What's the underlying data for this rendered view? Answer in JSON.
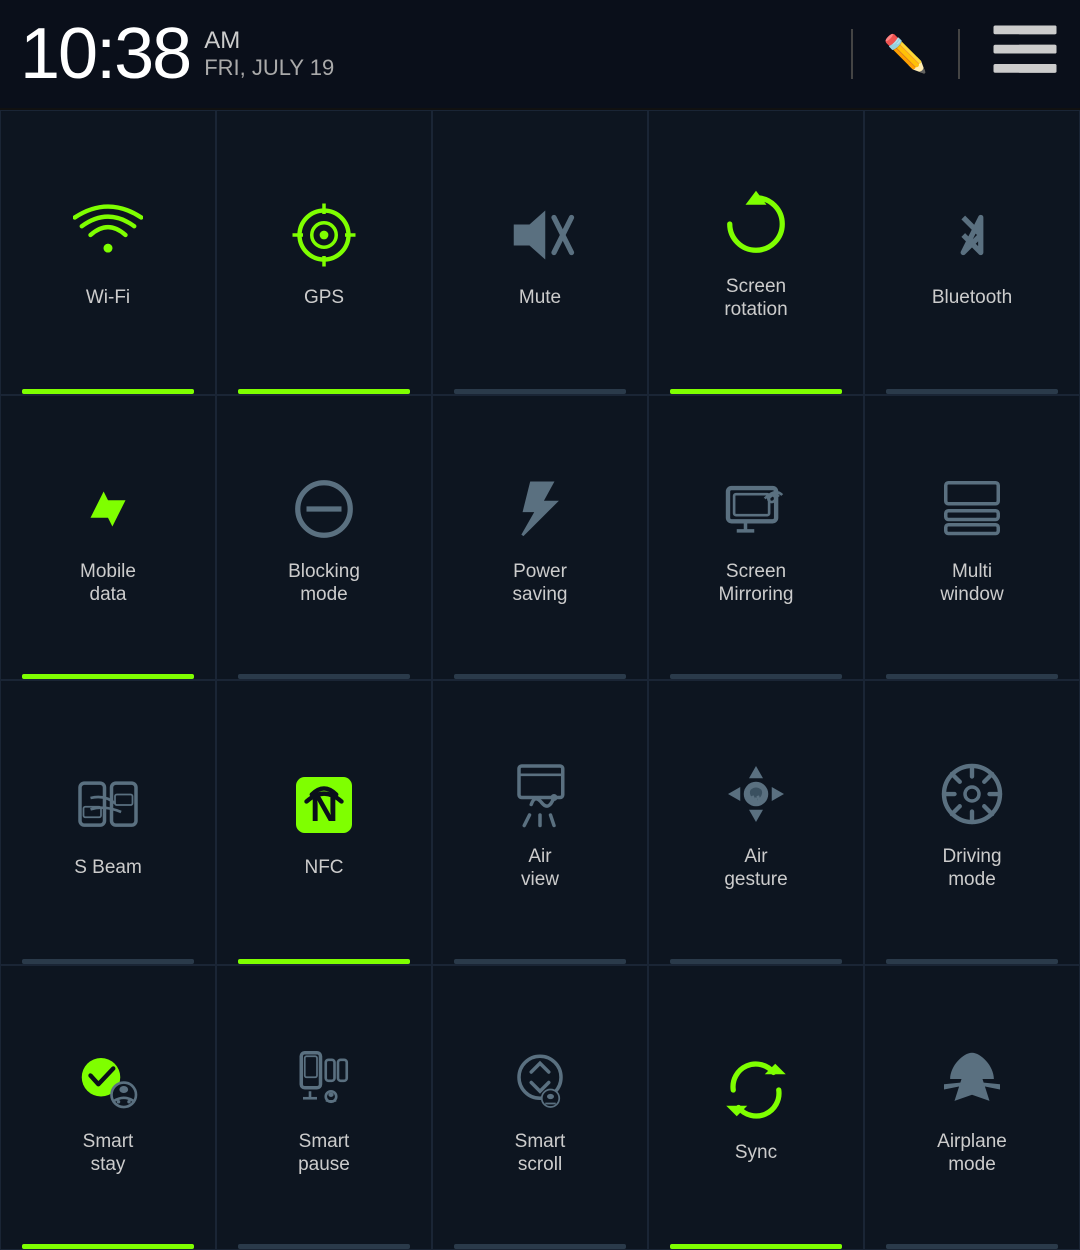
{
  "statusBar": {
    "time": "10:38",
    "ampm": "AM",
    "date": "FRI, JULY 19",
    "editIcon": "✏",
    "menuIcon": "≡"
  },
  "tiles": [
    {
      "id": "wifi",
      "label": "Wi-Fi",
      "active": true,
      "icon": "wifi"
    },
    {
      "id": "gps",
      "label": "GPS",
      "active": true,
      "icon": "gps"
    },
    {
      "id": "mute",
      "label": "Mute",
      "active": false,
      "icon": "mute"
    },
    {
      "id": "screen-rotation",
      "label": "Screen\nrotation",
      "active": true,
      "icon": "rotation"
    },
    {
      "id": "bluetooth",
      "label": "Bluetooth",
      "active": false,
      "icon": "bluetooth"
    },
    {
      "id": "mobile-data",
      "label": "Mobile\ndata",
      "active": true,
      "icon": "mobile-data"
    },
    {
      "id": "blocking-mode",
      "label": "Blocking\nmode",
      "active": false,
      "icon": "blocking"
    },
    {
      "id": "power-saving",
      "label": "Power\nsaving",
      "active": false,
      "icon": "power-saving"
    },
    {
      "id": "screen-mirroring",
      "label": "Screen\nMirroring",
      "active": false,
      "icon": "screen-mirroring"
    },
    {
      "id": "multi-window",
      "label": "Multi\nwindow",
      "active": false,
      "icon": "multi-window"
    },
    {
      "id": "s-beam",
      "label": "S Beam",
      "active": false,
      "icon": "s-beam"
    },
    {
      "id": "nfc",
      "label": "NFC",
      "active": true,
      "icon": "nfc"
    },
    {
      "id": "air-view",
      "label": "Air\nview",
      "active": false,
      "icon": "air-view"
    },
    {
      "id": "air-gesture",
      "label": "Air\ngesture",
      "active": false,
      "icon": "air-gesture"
    },
    {
      "id": "driving-mode",
      "label": "Driving\nmode",
      "active": false,
      "icon": "driving"
    },
    {
      "id": "smart-stay",
      "label": "Smart\nstay",
      "active": true,
      "icon": "smart-stay"
    },
    {
      "id": "smart-pause",
      "label": "Smart\npause",
      "active": false,
      "icon": "smart-pause"
    },
    {
      "id": "smart-scroll",
      "label": "Smart\nscroll",
      "active": false,
      "icon": "smart-scroll"
    },
    {
      "id": "sync",
      "label": "Sync",
      "active": true,
      "icon": "sync"
    },
    {
      "id": "airplane-mode",
      "label": "Airplane\nmode",
      "active": false,
      "icon": "airplane"
    }
  ]
}
